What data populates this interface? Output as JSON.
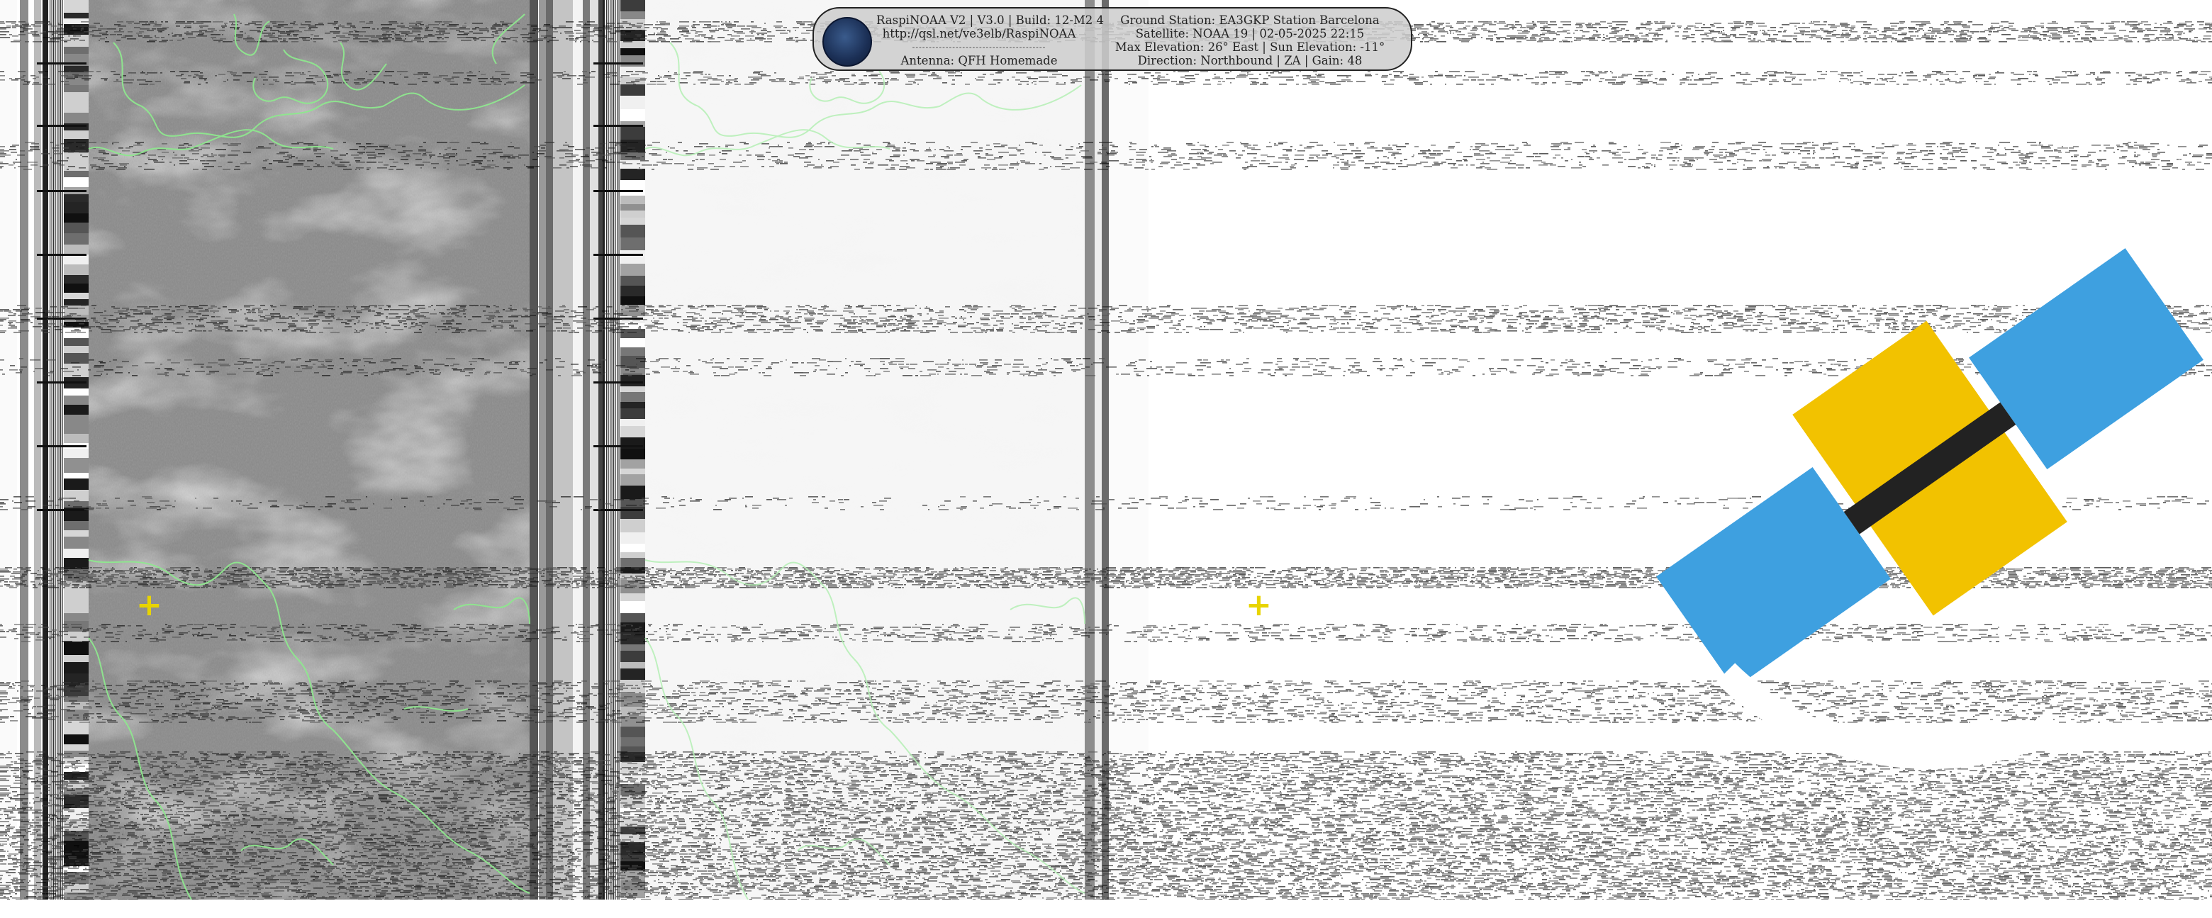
{
  "image_description_none": "",
  "header": {
    "line1": "RaspiNOAA V2 | V3.0 | Build: 12-M2 4",
    "line2": "http://qsl.net/ve3elb/RaspiNOAA",
    "separator": "----------------------------------------",
    "line4": "Antenna: QFH Homemade",
    "ground_station": "Ground Station: EA3GKP Station Barcelona",
    "satellite": "Satellite: NOAA 19 | 02-05-2025 22:15",
    "elevation": "Max Elevation: 26° East | Sun Elevation: -11°",
    "direction": "Direction: Northbound | ZA | Gain: 48"
  },
  "logo_icon": "satellite-icon",
  "marker_symbol": "+",
  "colors": {
    "map_overlay": "#8ee88e",
    "marker": "#e8d400",
    "background": "#ffffff"
  }
}
